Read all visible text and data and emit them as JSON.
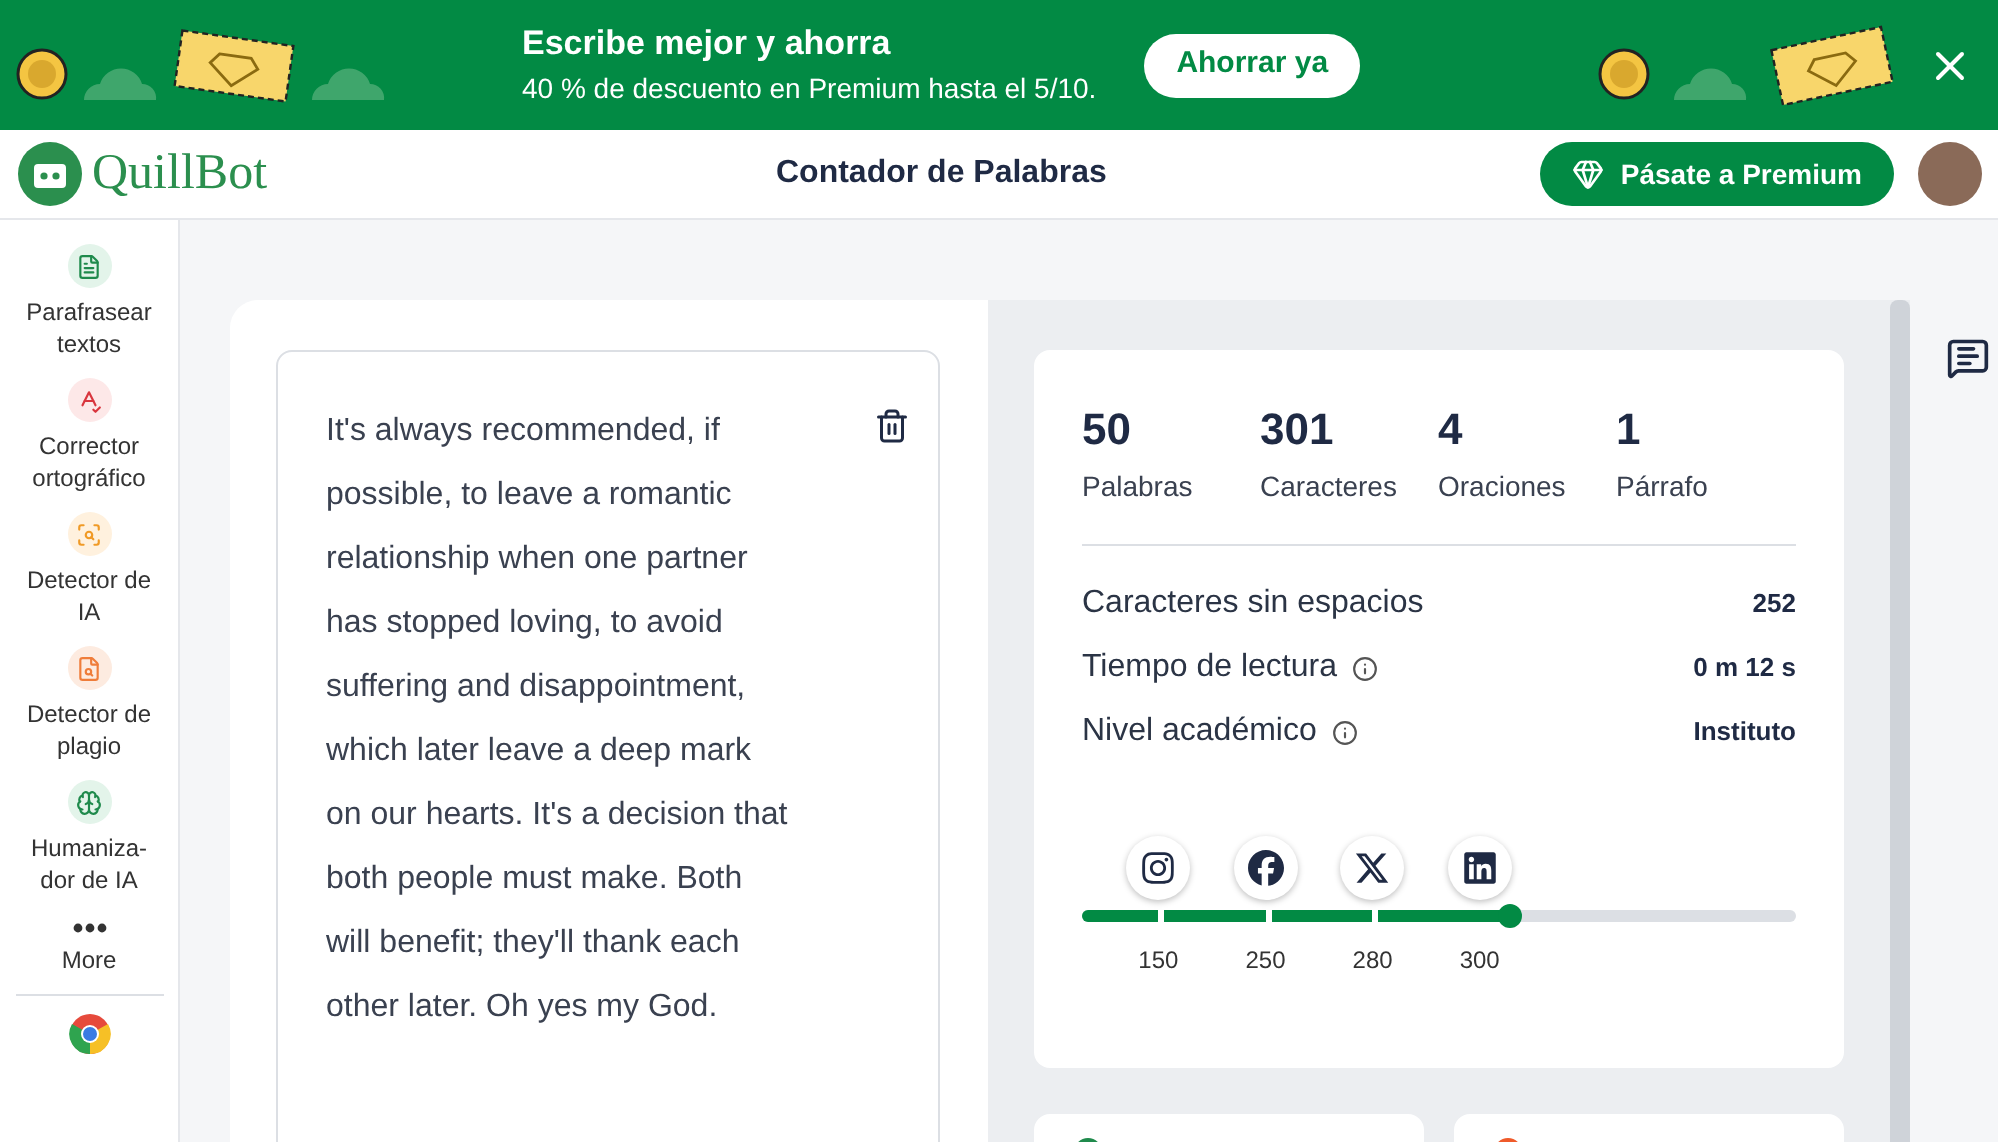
{
  "banner": {
    "title": "Escribe mejor y ahorra",
    "subtitle": "40 % de descuento en Premium hasta el 5/10.",
    "button": "Ahorrar ya"
  },
  "header": {
    "logo": "QuillBot",
    "title": "Contador de Palabras",
    "premium_button": "Pásate a Premium"
  },
  "sidebar": {
    "items": [
      {
        "kind": "paraphrase",
        "label": "Parafrasear textos"
      },
      {
        "kind": "grammar",
        "label": "Corrector ortográfico"
      },
      {
        "kind": "ai_detector",
        "label": "Detector de IA"
      },
      {
        "kind": "plagiarism",
        "label": "Detector de plagio"
      },
      {
        "kind": "humanizer",
        "label": "Humaniza-dor de IA"
      },
      {
        "kind": "more",
        "label": "More"
      },
      {
        "kind": "chrome"
      }
    ]
  },
  "editor": {
    "text": "It's always recommended, if possible, to leave a romantic relationship when one partner has stopped loving, to avoid suffering and disappointment, which later leave a deep mark on our hearts. It's a decision that both people must make. Both will benefit; they'll thank each other later. Oh yes my God."
  },
  "stats": [
    {
      "value": "50",
      "label": "Palabras"
    },
    {
      "value": "301",
      "label": "Caracteres"
    },
    {
      "value": "4",
      "label": "Oraciones"
    },
    {
      "value": "1",
      "label": "Párrafo"
    }
  ],
  "details": [
    {
      "label": "Caracteres sin espacios",
      "value": "252",
      "info": false
    },
    {
      "label": "Tiempo de lectura",
      "value": "0 m 12 s",
      "info": true
    },
    {
      "label": "Nivel académico",
      "value": "Instituto",
      "info": true
    }
  ],
  "milestones": {
    "level": 0.6,
    "items": [
      {
        "kind": "instagram",
        "label": "150"
      },
      {
        "kind": "facebook",
        "label": "250"
      },
      {
        "kind": "x",
        "label": "280"
      },
      {
        "kind": "linkedin",
        "label": "300"
      }
    ]
  }
}
